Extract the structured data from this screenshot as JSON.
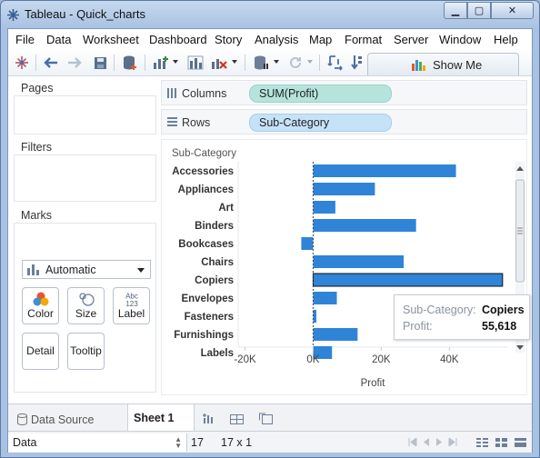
{
  "window": {
    "title": "Tableau - Quick_charts"
  },
  "menu": [
    "File",
    "Data",
    "Worksheet",
    "Dashboard",
    "Story",
    "Analysis",
    "Map",
    "Format",
    "Server",
    "Window",
    "Help"
  ],
  "toolbar": {
    "show_me_label": "Show Me"
  },
  "cards": {
    "pages": "Pages",
    "filters": "Filters",
    "marks": "Marks"
  },
  "marks": {
    "type_label": "Automatic",
    "buttons": [
      "Color",
      "Size",
      "Label",
      "Detail",
      "Tooltip"
    ],
    "label_icon_text": "Abc\n123"
  },
  "shelves": {
    "columns_label": "Columns",
    "columns_pill": "SUM(Profit)",
    "rows_label": "Rows",
    "rows_pill": "Sub-Category"
  },
  "chart_data": {
    "type": "bar",
    "orientation": "horizontal",
    "row_header": "Sub-Category",
    "xlabel": "Profit",
    "categories": [
      "Accessories",
      "Appliances",
      "Art",
      "Binders",
      "Bookcases",
      "Chairs",
      "Copiers",
      "Envelopes",
      "Fasteners",
      "Furnishings",
      "Labels"
    ],
    "values": [
      41937,
      18138,
      6528,
      30222,
      -3473,
      26590,
      55618,
      6964,
      950,
      13059,
      5546
    ],
    "xticks": [
      -20000,
      0,
      20000,
      40000
    ],
    "xtick_labels": [
      "-20K",
      "0K",
      "20K",
      "40K"
    ],
    "xlim": [
      -22000,
      57000
    ],
    "selected": "Copiers",
    "bar_color": "#2f84d8"
  },
  "tooltip": {
    "key1": "Sub-Category:",
    "val1": "Copiers",
    "key2": "Profit:",
    "val2": "55,618"
  },
  "tabs": {
    "data_source": "Data Source",
    "sheet": "Sheet 1"
  },
  "status": {
    "data_label": "Data",
    "marks_count": "17",
    "dims": "17 x 1"
  }
}
